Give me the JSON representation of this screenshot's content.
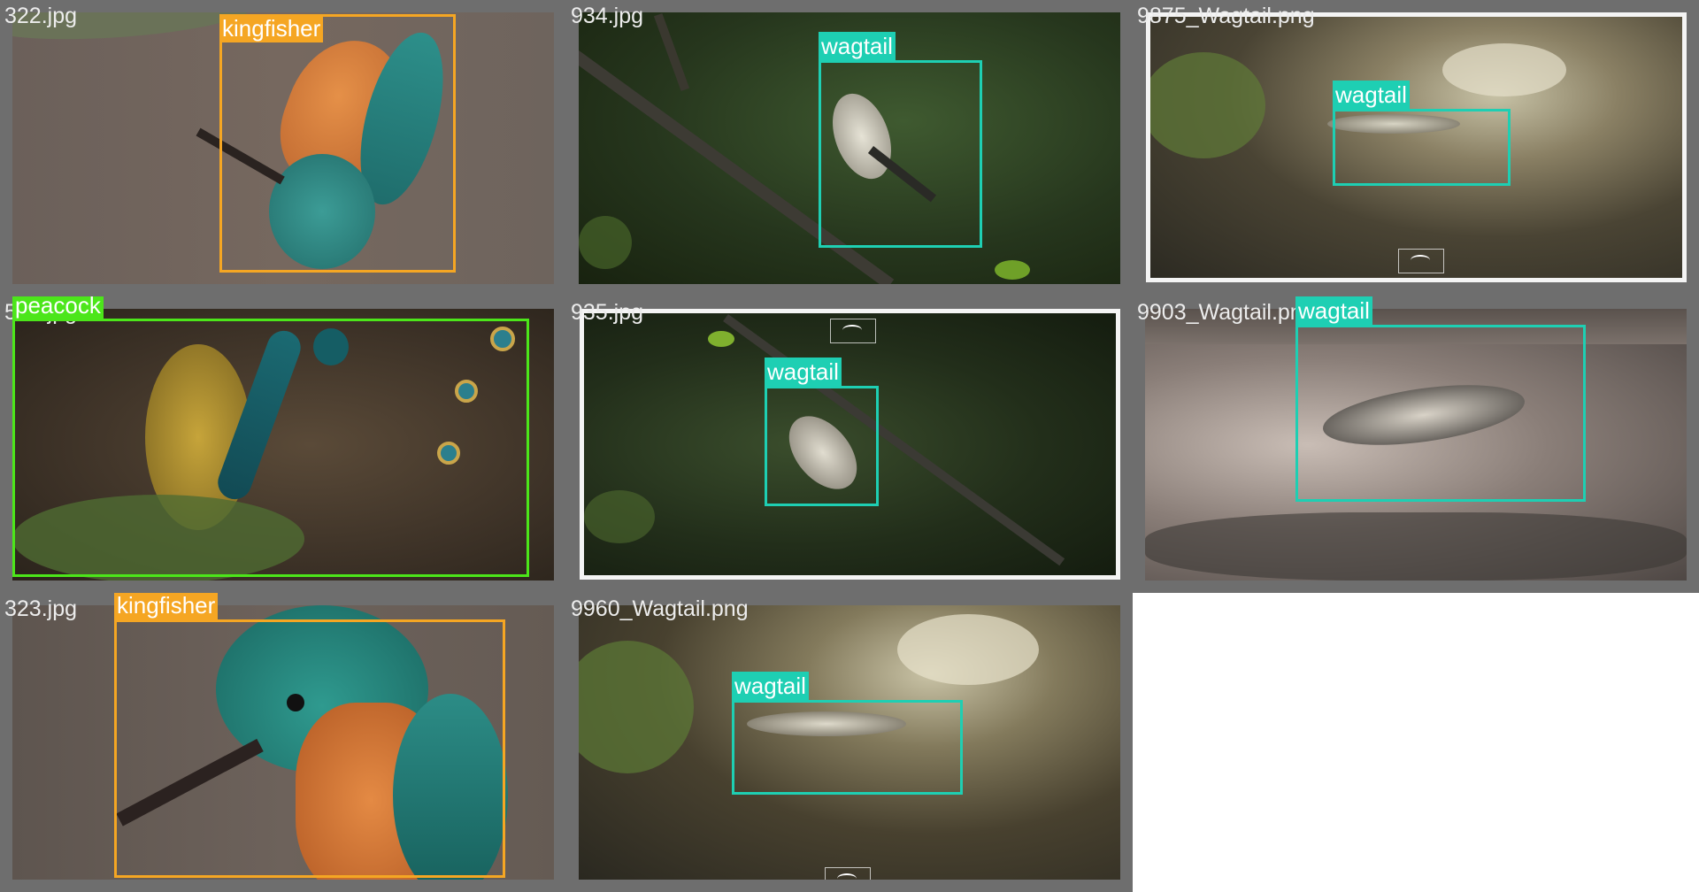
{
  "grid": {
    "tiles": [
      {
        "filename": "322.jpg",
        "label": "kingfisher"
      },
      {
        "filename": "934.jpg",
        "label": "wagtail"
      },
      {
        "filename": "9875_Wagtail.png",
        "label": "wagtail"
      },
      {
        "filename": "578.jpg",
        "label": "peacock"
      },
      {
        "filename": "935.jpg",
        "label": "wagtail"
      },
      {
        "filename": "9903_Wagtail.png",
        "label": "wagtail"
      },
      {
        "filename": "323.jpg",
        "label": "kingfisher"
      },
      {
        "filename": "9960_Wagtail.png",
        "label": "wagtail"
      }
    ]
  },
  "colors": {
    "kingfisher": "#f5a623",
    "wagtail": "#1ecfb3",
    "peacock": "#4ce61a",
    "tile_border": "#6e6e6e"
  }
}
